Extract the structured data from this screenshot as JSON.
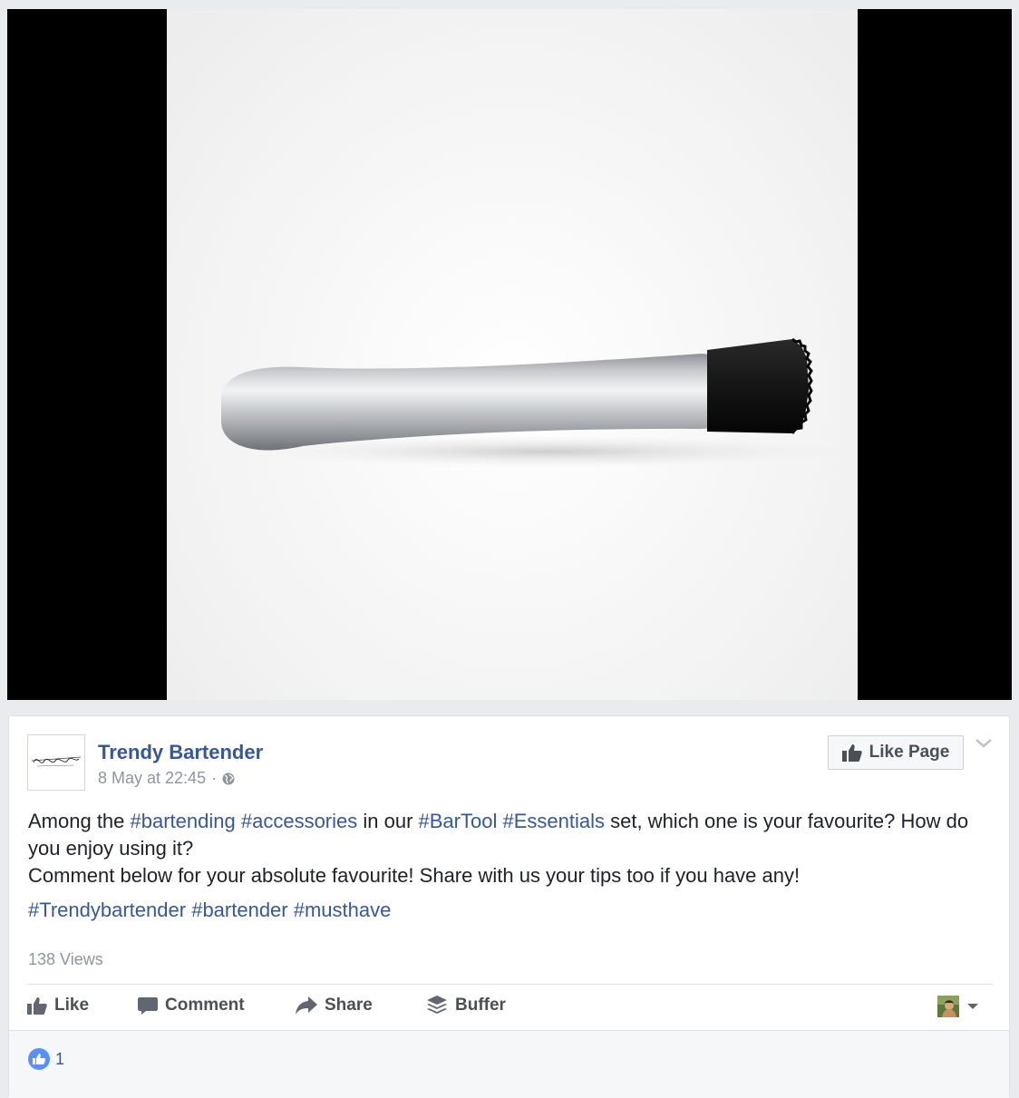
{
  "post": {
    "image_alt": "Stainless steel bar muddler with black serrated head on white background",
    "page_name": "Trendy Bartender",
    "avatar_logo_text": "Trendy Bartender",
    "timestamp": "8 May at 22:45",
    "separator": "·",
    "privacy_icon": "globe-icon",
    "like_page_label": "Like Page",
    "text": {
      "seg1": "Among the ",
      "tag1": "#bartending",
      "seg2": " ",
      "tag2": "#accessories",
      "seg3": " in our ",
      "tag3": "#BarTool",
      "seg4": " ",
      "tag4": "#Essentials",
      "seg5": " set, which one is your favourite? How do you enjoy using it?",
      "line2": "Comment below for your absolute favourite! Share with us your tips too if you have any!"
    },
    "hashtags": [
      "#Trendybartender",
      "#bartender",
      "#musthave"
    ],
    "views": "138 Views"
  },
  "actions": {
    "like": "Like",
    "comment": "Comment",
    "share": "Share",
    "buffer": "Buffer"
  },
  "reactions": {
    "like_count": "1"
  },
  "colors": {
    "link": "#365899",
    "text": "#1d2129",
    "muted": "#90949c",
    "action": "#4b4f56",
    "reaction_blue": "#5890ff"
  }
}
